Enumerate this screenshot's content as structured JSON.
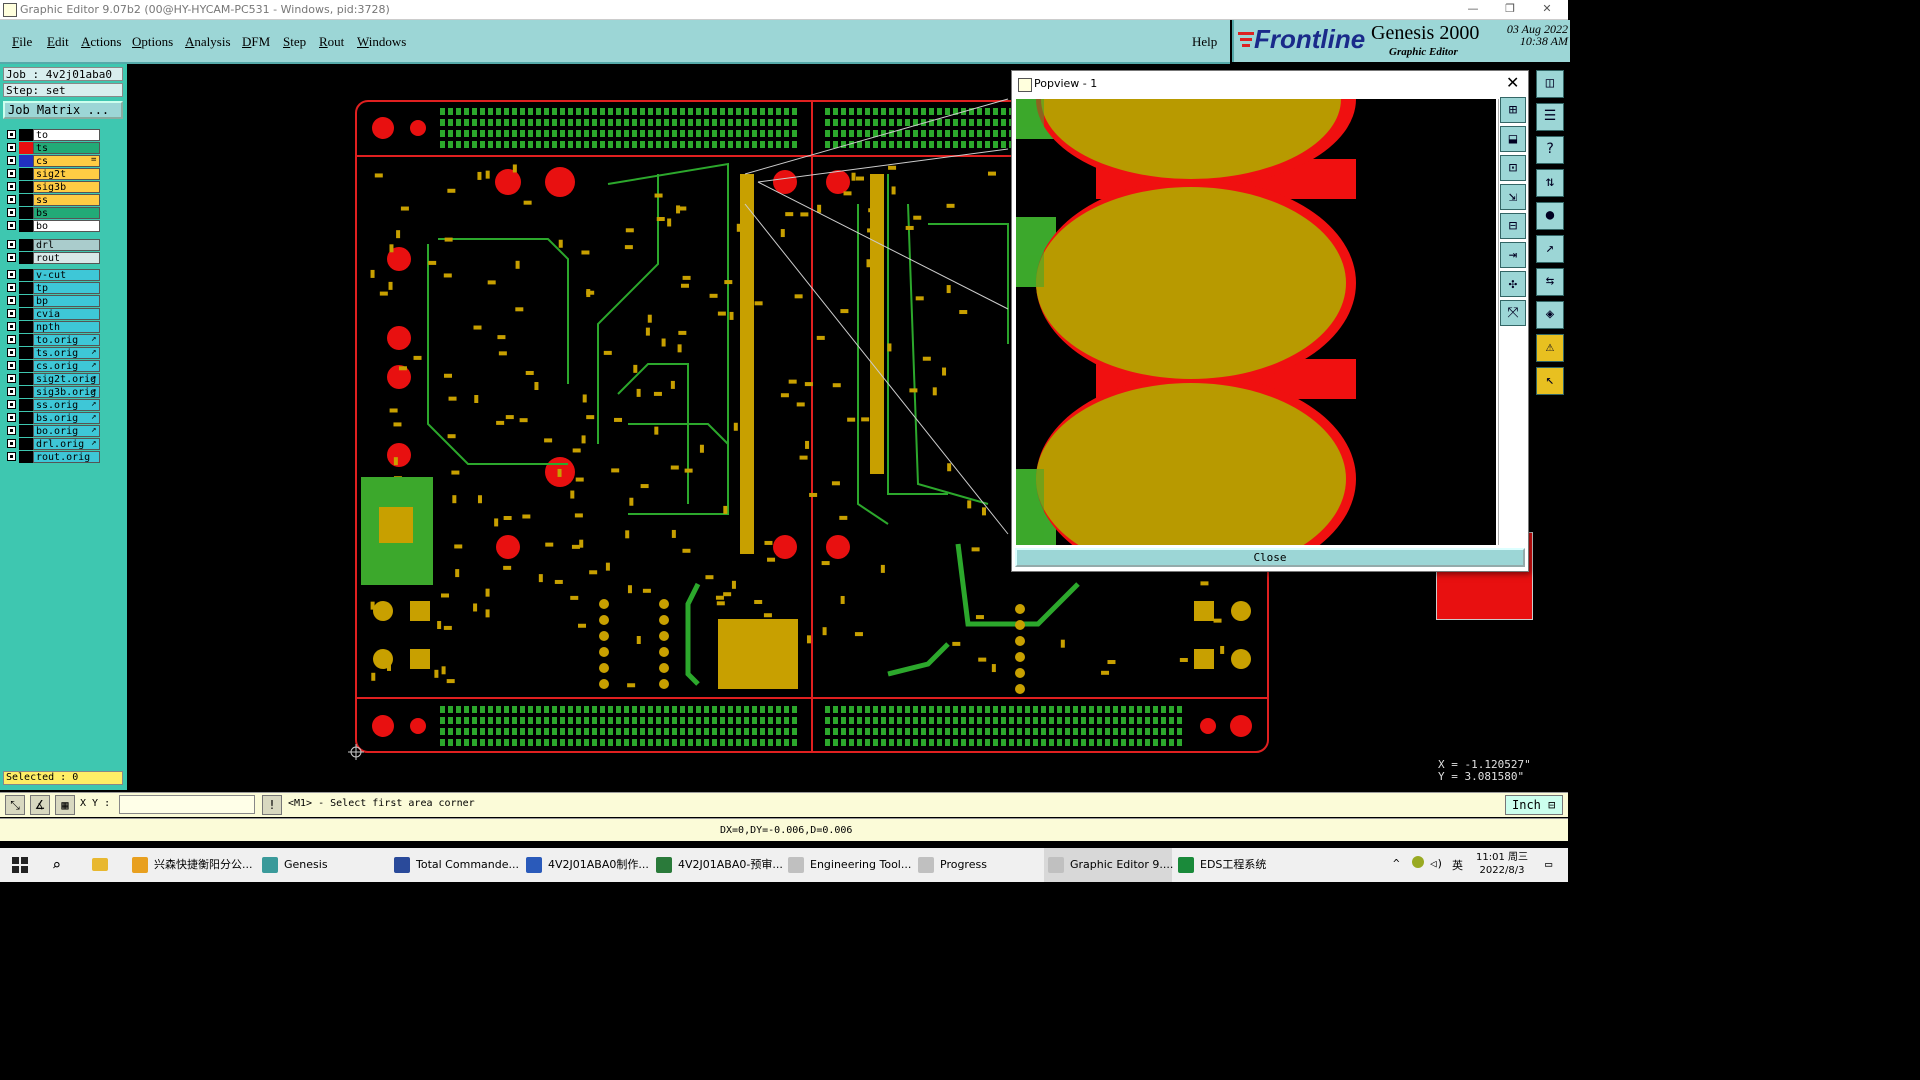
{
  "window": {
    "title": "Graphic Editor 9.07b2 (00@HY-HYCAM-PC531 - Windows, pid:3728)"
  },
  "menu": [
    "File",
    "Edit",
    "Actions",
    "Options",
    "Analysis",
    "DFM",
    "Step",
    "Rout",
    "Windows"
  ],
  "help_label": "Help",
  "brand": {
    "logo": "Frontline",
    "product": "Genesis 2000",
    "subtitle": "Graphic Editor",
    "date": "03 Aug 2022",
    "time": "10:38 AM"
  },
  "job": {
    "job_line": "Job : 4v2j01aba0",
    "step_line": "Step: set",
    "matrix_button": "Job Matrix ..."
  },
  "layers": [
    {
      "name": "to",
      "color": "#ffffff"
    },
    {
      "name": "ts",
      "color": "#22aa77"
    },
    {
      "name": "cs",
      "color": "#ffcc44",
      "marker": "="
    },
    {
      "name": "sig2t",
      "color": "#ffcc44"
    },
    {
      "name": "sig3b",
      "color": "#ffcc44"
    },
    {
      "name": "ss",
      "color": "#ffcc44"
    },
    {
      "name": "bs",
      "color": "#22aa77"
    },
    {
      "name": "bo",
      "color": "#ffffff"
    },
    {
      "name": "drl",
      "color": "#aacccc"
    },
    {
      "name": "rout",
      "color": "#d8e8e8"
    },
    {
      "name": "v-cut",
      "color": "#3ec7d7"
    },
    {
      "name": "tp",
      "color": "#3ec7d7"
    },
    {
      "name": "bp",
      "color": "#3ec7d7"
    },
    {
      "name": "cvia",
      "color": "#3ec7d7"
    },
    {
      "name": "npth",
      "color": "#3ec7d7"
    },
    {
      "name": "to.orig",
      "color": "#3ec7d7",
      "marker": "↗"
    },
    {
      "name": "ts.orig",
      "color": "#3ec7d7",
      "marker": "↗"
    },
    {
      "name": "cs.orig",
      "color": "#3ec7d7",
      "marker": "↗"
    },
    {
      "name": "sig2t.orig",
      "color": "#3ec7d7",
      "marker": "↗"
    },
    {
      "name": "sig3b.orig",
      "color": "#3ec7d7",
      "marker": "↗"
    },
    {
      "name": "ss.orig",
      "color": "#3ec7d7",
      "marker": "↗"
    },
    {
      "name": "bs.orig",
      "color": "#3ec7d7",
      "marker": "↗"
    },
    {
      "name": "bo.orig",
      "color": "#3ec7d7",
      "marker": "↗"
    },
    {
      "name": "drl.orig",
      "color": "#3ec7d7",
      "marker": "↗"
    },
    {
      "name": "rout.orig",
      "color": "#3ec7d7"
    }
  ],
  "selected_label": "Selected : 0",
  "cmd": {
    "xy_label": "X Y :",
    "prompt": "<M1> - Select first area corner",
    "units": "Inch"
  },
  "status": {
    "deltas": "DX=0,DY=-0.006,D=0.006"
  },
  "coords": {
    "x": "X = -1.120527\"",
    "y": "Y = 3.081580\""
  },
  "popview": {
    "title": "Popview - 1",
    "close_label": "Close"
  },
  "taskbar": {
    "items": [
      {
        "label": "兴森快捷衡阳分公...",
        "color": "#e8a020"
      },
      {
        "label": "Genesis",
        "color": "#3a9a9a"
      },
      {
        "label": "Total Commande...",
        "color": "#2a4a9a"
      },
      {
        "label": "4V2J01ABA0制作...",
        "color": "#2a5aba"
      },
      {
        "label": "4V2J01ABA0-预审...",
        "color": "#2a7a3a"
      },
      {
        "label": "Engineering Tool...",
        "color": "#c0c0c0"
      },
      {
        "label": "Progress",
        "color": "#c0c0c0"
      },
      {
        "label": "Graphic Editor 9....",
        "color": "#c0c0c0"
      },
      {
        "label": "EDS工程系统",
        "color": "#1a8a3a"
      }
    ],
    "tray_lang": "英",
    "time": "11:01 周三",
    "date": "2022/8/3"
  }
}
